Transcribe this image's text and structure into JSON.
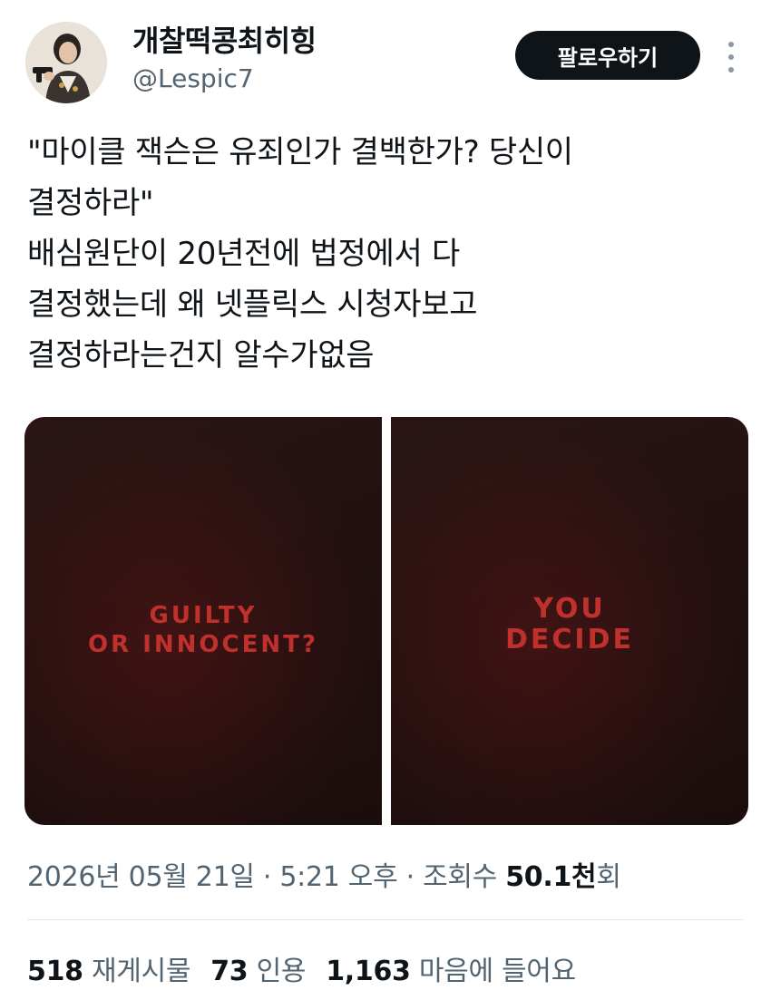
{
  "user": {
    "display_name": "개찰떡콩최히힝",
    "handle": "@Lespic7"
  },
  "header": {
    "follow_label": "팔로우하기",
    "more_icon": "more-vertical-icon"
  },
  "tweet": {
    "lines": [
      "\"마이클 잭슨은 유죄인가 결백한가? 당신이",
      "결정하라\"",
      "배심원단이 20년전에 법정에서 다",
      "결정했는데 왜 넷플릭스 시청자보고",
      "결정하라는건지 알수가없음"
    ]
  },
  "media": {
    "left_text": "GUILTY\nOR INNOCENT?",
    "right_text": "YOU\nDECIDE",
    "accent_color": "#c0302c",
    "background_color": "#221010"
  },
  "meta": {
    "date": "2026년 05월 21일 · 5:21 오후 · 조회수 ",
    "views_count": "50.1천",
    "views_suffix": "회"
  },
  "stats": {
    "reposts_count": "518",
    "reposts_label": "재게시물",
    "quotes_count": "73",
    "quotes_label": "인용",
    "likes_count": "1,163",
    "likes_label": "마음에 들어요"
  }
}
